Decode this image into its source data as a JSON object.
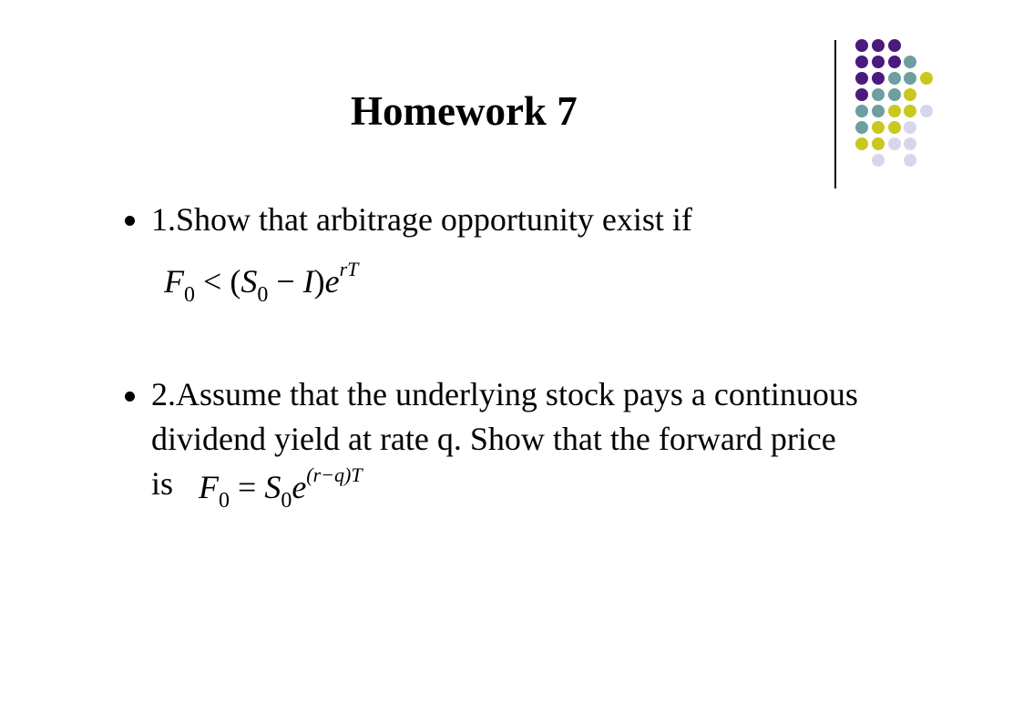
{
  "slide": {
    "title": "Homework 7",
    "bullets": [
      {
        "line1": "1.Show that arbitrage opportunity exist if",
        "formula": {
          "lhs_var": "F",
          "lhs_sub": "0",
          "rel": "<",
          "open": "(",
          "s_var": "S",
          "s_sub": "0",
          "minus": "−",
          "i_var": "I",
          "close": ")",
          "base": "e",
          "exp": "rT"
        }
      },
      {
        "line1": "2.Assume that the underlying stock pays a continuous",
        "line2": "dividend yield at rate q. Show that the forward price",
        "line3_prefix": "is",
        "formula": {
          "lhs_var": "F",
          "lhs_sub": "0",
          "rel": "=",
          "s_var": "S",
          "s_sub": "0",
          "base": "e",
          "exp": "(r−q)T"
        }
      }
    ]
  },
  "decoration": {
    "colors": {
      "purple": "#4b1a7d",
      "teal": "#6f9ea0",
      "yellow": "#c9c81e",
      "lavender": "#d8d6ea"
    }
  }
}
